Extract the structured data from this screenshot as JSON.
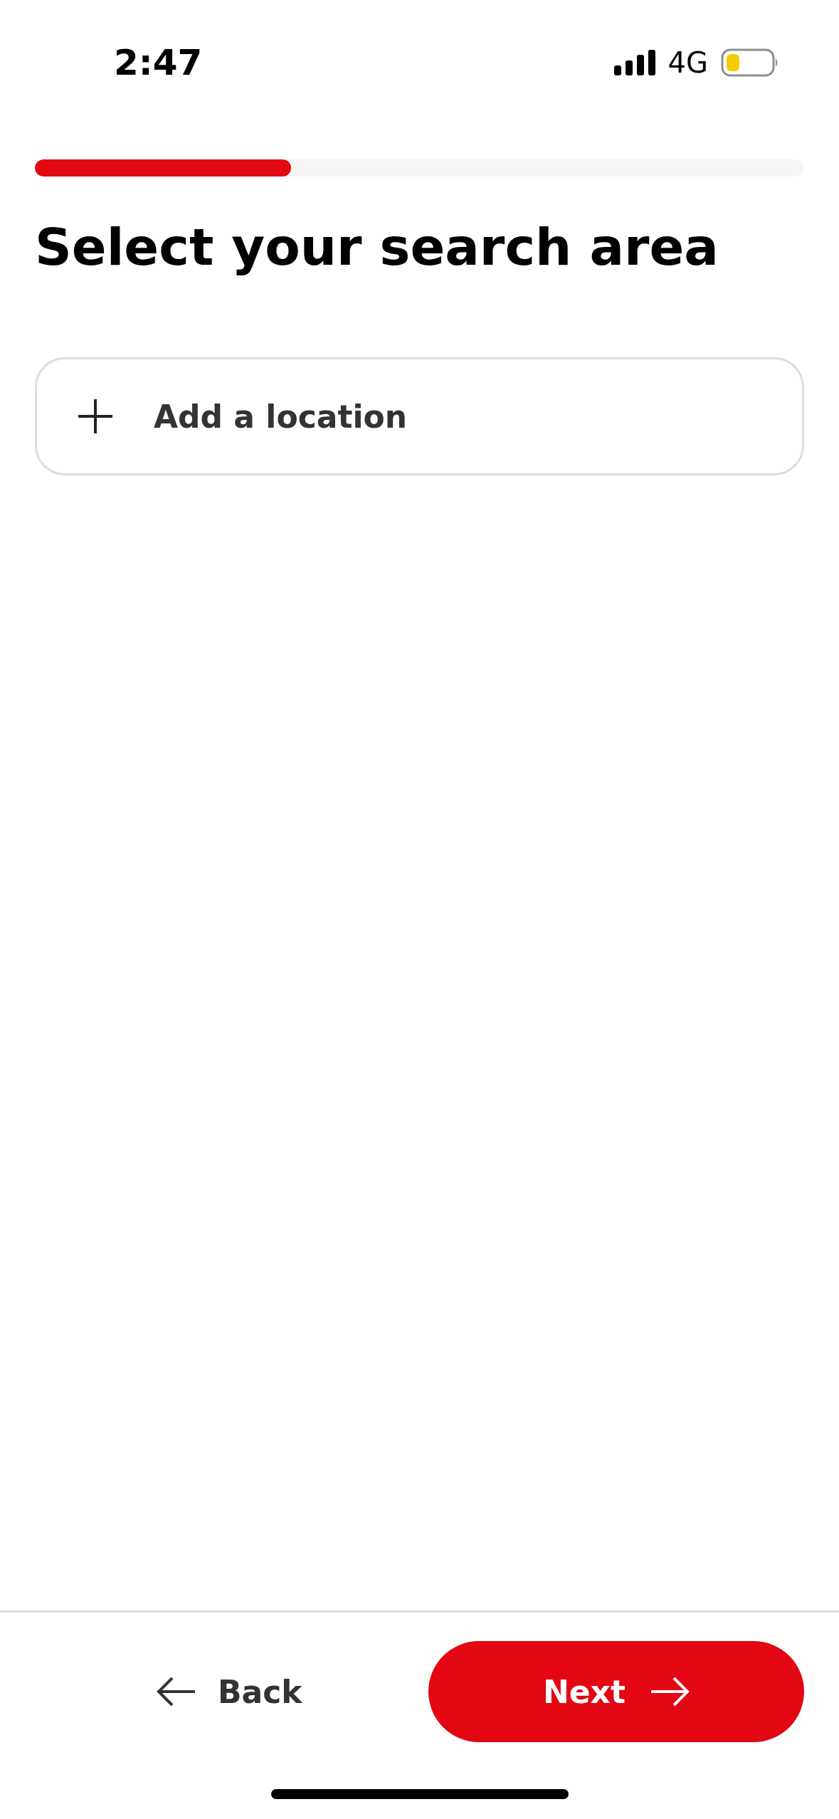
{
  "status_bar": {
    "time": "2:47",
    "network": "4G"
  },
  "progress": {
    "level": 0.333
  },
  "title": "Select your search area",
  "add_location": {
    "label": "Add a location"
  },
  "footer": {
    "back": "Back",
    "next": "Next"
  }
}
